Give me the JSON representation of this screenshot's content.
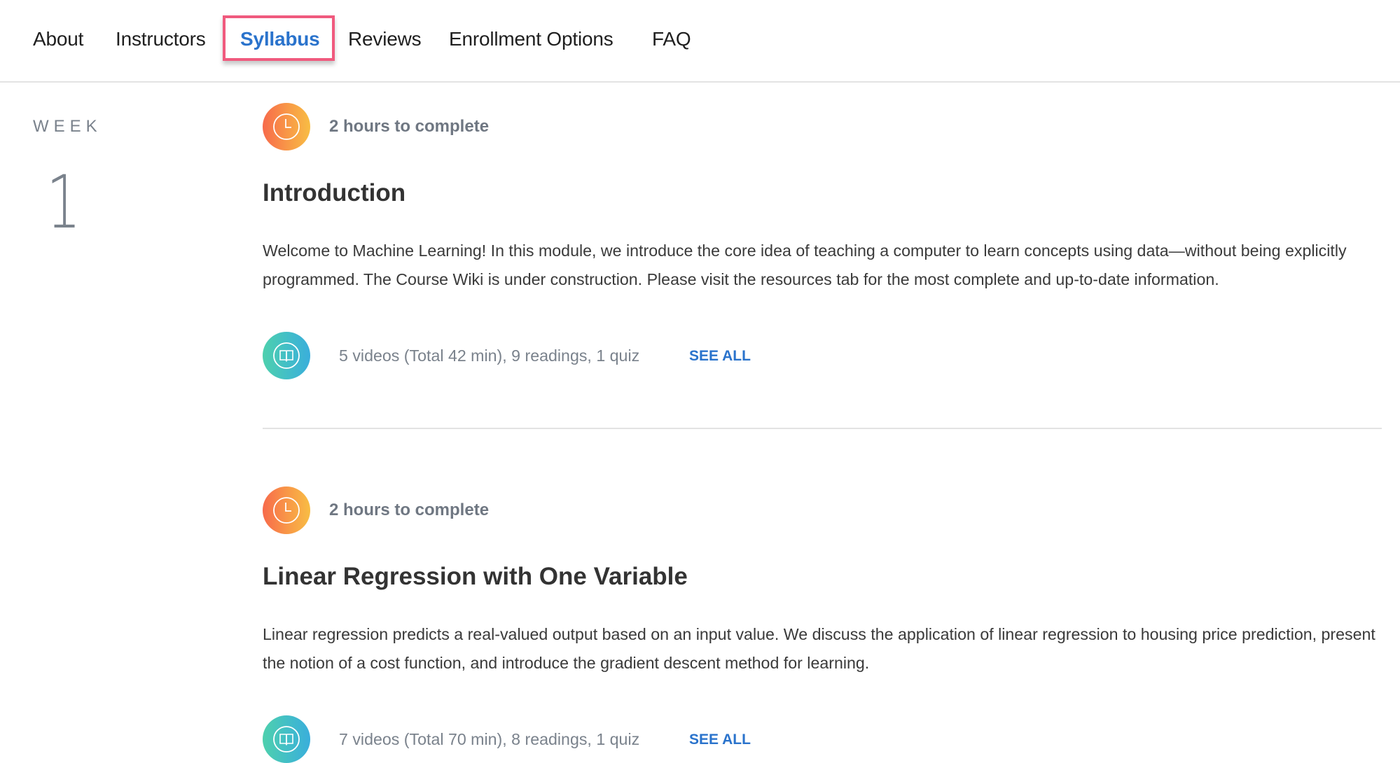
{
  "nav": {
    "items": [
      {
        "label": "About",
        "active": false
      },
      {
        "label": "Instructors",
        "active": false
      },
      {
        "label": "Syllabus",
        "active": true
      },
      {
        "label": "Reviews",
        "active": false
      },
      {
        "label": "Enrollment Options",
        "active": false
      },
      {
        "label": "FAQ",
        "active": false
      }
    ],
    "highlight_color": "#f05a7e",
    "active_color": "#2a73cc"
  },
  "week": {
    "label": "WEEK",
    "number": "1"
  },
  "modules": [
    {
      "duration_icon": "clock-icon",
      "duration": "2 hours to complete",
      "title": "Introduction",
      "description": "Welcome to Machine Learning! In this module, we introduce the core idea of teaching a computer to learn concepts using data—without being explicitly programmed. The Course Wiki is under construction. Please visit the resources tab for the most complete and up-to-date information.",
      "content_icon": "book-icon",
      "content_summary": "5 videos (Total 42 min), 9 readings, 1 quiz",
      "see_all": "SEE ALL"
    },
    {
      "duration_icon": "clock-icon",
      "duration": "2 hours to complete",
      "title": "Linear Regression with One Variable",
      "description": "Linear regression predicts a real-valued output based on an input value. We discuss the application of linear regression to housing price prediction, present the notion of a cost function, and introduce the gradient descent method for learning.",
      "content_icon": "book-icon",
      "content_summary": "7 videos (Total 70 min), 8 readings, 1 quiz",
      "see_all": "SEE ALL"
    }
  ]
}
